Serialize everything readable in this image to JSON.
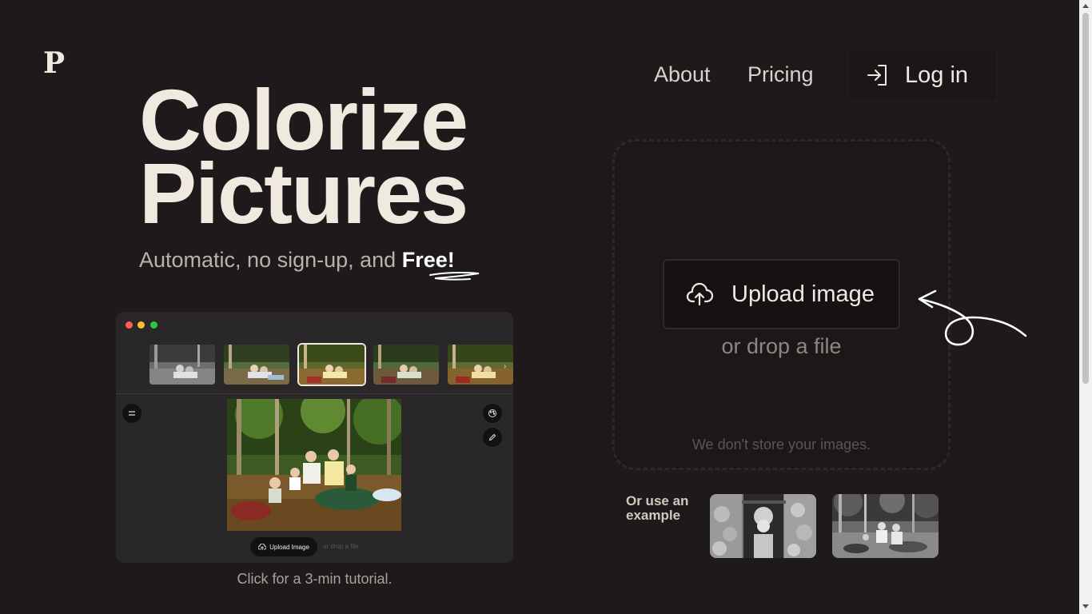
{
  "logo": {
    "text": "P"
  },
  "nav": {
    "about": "About",
    "pricing": "Pricing",
    "login": "Log in"
  },
  "hero": {
    "title_line1": "Colorize",
    "title_line2": "Pictures",
    "subtitle_prefix": "Automatic, no sign-up, and ",
    "subtitle_emphasis": "Free!"
  },
  "tutorial": {
    "upload_label": "Upload Image",
    "drop_label": "or drop a file",
    "caption": "Click for a 3-min tutorial."
  },
  "upload": {
    "button_label": "Upload image",
    "drop_text": "or drop a file",
    "privacy_note": "We don't store your images."
  },
  "examples": {
    "label_line1": "Or use an",
    "label_line2": "example"
  },
  "colors": {
    "background": "#1e1a1b",
    "text": "#efe9df",
    "window": "#2a2729"
  },
  "icons": {
    "login": "login-icon",
    "upload": "cloud-upload-icon",
    "palette": "palette-icon",
    "pencil": "pencil-icon",
    "menu": "menu-icon"
  }
}
